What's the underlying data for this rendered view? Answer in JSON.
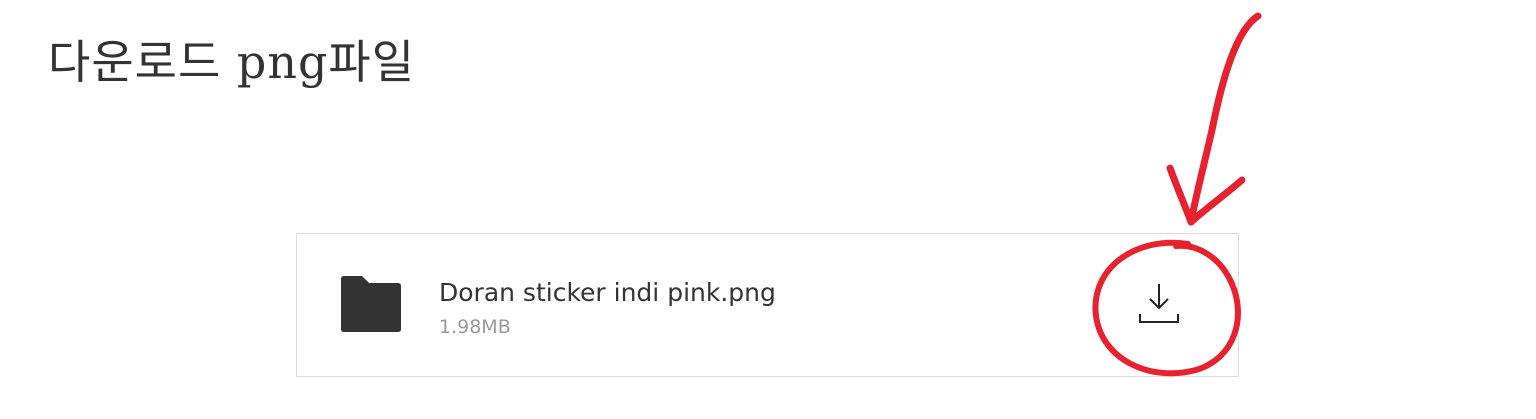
{
  "page": {
    "title": "다운로드 png파일"
  },
  "file": {
    "name": "Doran sticker indi pink.png",
    "size": "1.98MB",
    "icon": "folder-icon"
  },
  "download": {
    "icon": "download-icon"
  },
  "annotation": {
    "color": "#e8212e",
    "shapes": [
      "arrow",
      "circle"
    ]
  }
}
